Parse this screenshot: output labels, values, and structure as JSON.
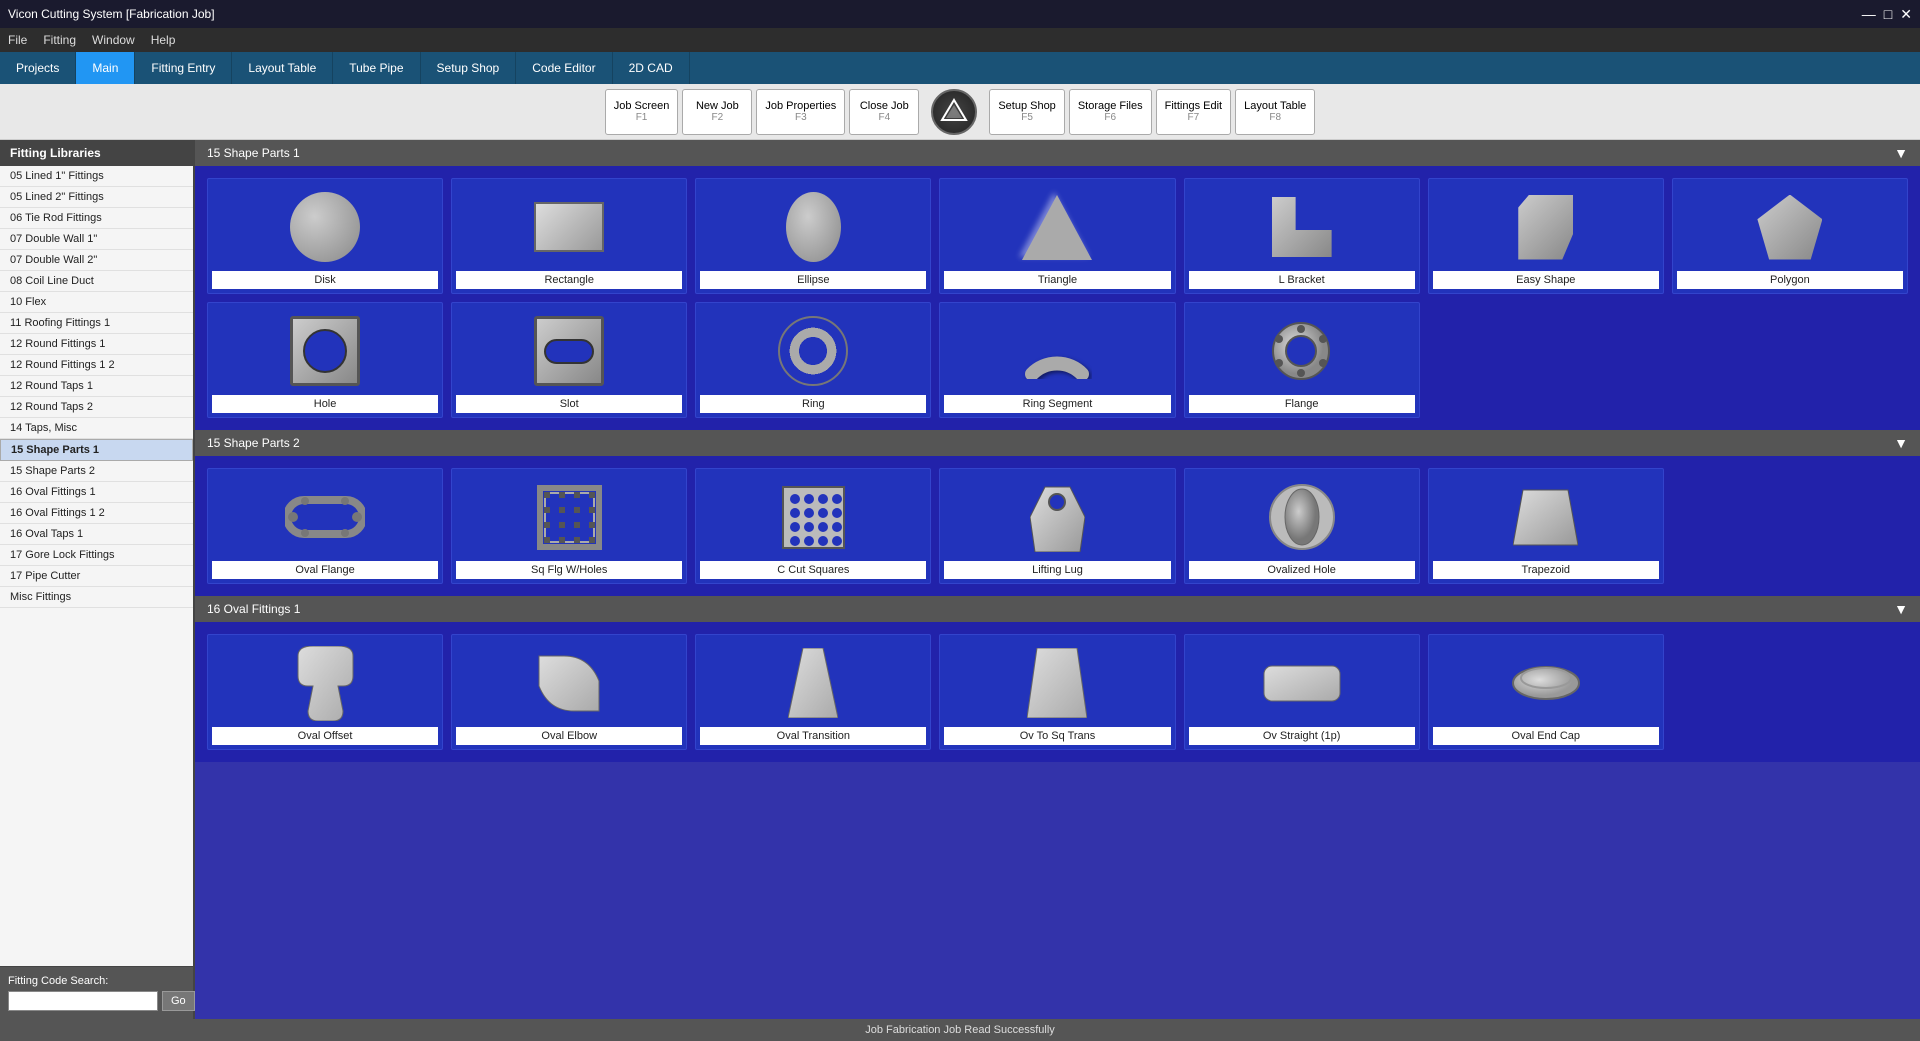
{
  "window": {
    "title": "Vicon Cutting System [Fabrication Job]",
    "controls": [
      "—",
      "□",
      "✕"
    ]
  },
  "menu": {
    "items": [
      "File",
      "Fitting",
      "Window",
      "Help"
    ]
  },
  "tabs": [
    {
      "label": "Projects",
      "active": false
    },
    {
      "label": "Main",
      "active": true
    },
    {
      "label": "Fitting Entry",
      "active": false
    },
    {
      "label": "Layout Table",
      "active": false
    },
    {
      "label": "Tube Pipe",
      "active": false
    },
    {
      "label": "Setup Shop",
      "active": false
    },
    {
      "label": "Code Editor",
      "active": false
    },
    {
      "label": "2D CAD",
      "active": false
    }
  ],
  "toolbar": {
    "buttons": [
      {
        "label": "Job\nScreen",
        "key": "F1"
      },
      {
        "label": "New\nJob",
        "key": "F2"
      },
      {
        "label": "Job\nProperties",
        "key": "F3"
      },
      {
        "label": "Close\nJob",
        "key": "F4"
      },
      {
        "label": "Setup\nShop",
        "key": "F5"
      },
      {
        "label": "Storage\nFiles",
        "key": "F6"
      },
      {
        "label": "Fittings\nEdit",
        "key": "F7"
      },
      {
        "label": "Layout\nTable",
        "key": "F8"
      }
    ]
  },
  "sidebar": {
    "header": "Fitting Libraries",
    "items": [
      "05 Lined 1\" Fittings",
      "05 Lined 2\" Fittings",
      "06 Tie Rod Fittings",
      "07 Double Wall 1\"",
      "07 Double Wall 2\"",
      "08 Coil Line Duct",
      "10 Flex",
      "11 Roofing Fittings 1",
      "12 Round Fittings 1",
      "12 Round Fittings 1 2",
      "12 Round Taps 1",
      "12 Round Taps 2",
      "14 Taps, Misc",
      "15 Shape Parts 1",
      "15 Shape Parts 2",
      "16 Oval Fittings 1",
      "16 Oval Fittings 1 2",
      "16 Oval Taps 1",
      "17 Gore Lock Fittings",
      "17 Pipe Cutter",
      "Misc Fittings"
    ],
    "selected_index": 13,
    "search_label": "Fitting Code Search:",
    "search_placeholder": "",
    "search_go": "Go"
  },
  "sections": [
    {
      "id": "section1",
      "header": "15 Shape Parts 1",
      "items": [
        {
          "label": "Disk",
          "shape": "disk"
        },
        {
          "label": "Rectangle",
          "shape": "rectangle"
        },
        {
          "label": "Ellipse",
          "shape": "ellipse"
        },
        {
          "label": "Triangle",
          "shape": "triangle"
        },
        {
          "label": "L Bracket",
          "shape": "lbracket"
        },
        {
          "label": "Easy Shape",
          "shape": "easyshape"
        },
        {
          "label": "Polygon",
          "shape": "polygon"
        },
        {
          "label": "Hole",
          "shape": "hole"
        },
        {
          "label": "Slot",
          "shape": "slot"
        },
        {
          "label": "Ring",
          "shape": "ring"
        },
        {
          "label": "Ring Segment",
          "shape": "ringsegment"
        },
        {
          "label": "Flange",
          "shape": "flange"
        }
      ]
    },
    {
      "id": "section2",
      "header": "15 Shape Parts 2",
      "items": [
        {
          "label": "Oval Flange",
          "shape": "ovalflange"
        },
        {
          "label": "Sq Flg W/Holes",
          "shape": "sqflg"
        },
        {
          "label": "C Cut Squares",
          "shape": "ccut"
        },
        {
          "label": "Lifting Lug",
          "shape": "liftinglug"
        },
        {
          "label": "Ovalized Hole",
          "shape": "ovalized"
        },
        {
          "label": "Trapezoid",
          "shape": "trapezoid"
        }
      ]
    },
    {
      "id": "section3",
      "header": "16 Oval Fittings 1",
      "items": [
        {
          "label": "Oval Offset",
          "shape": "ovaloffset"
        },
        {
          "label": "Oval Elbow",
          "shape": "ovalelbow"
        },
        {
          "label": "Oval Transition",
          "shape": "ovaltrans"
        },
        {
          "label": "Ov To Sq Trans",
          "shape": "ovtosq"
        },
        {
          "label": "Ov Straight (1p)",
          "shape": "ovstraight"
        },
        {
          "label": "Oval End Cap",
          "shape": "ovalendcap"
        }
      ]
    }
  ],
  "status": {
    "text": "Job Fabrication Job Read Successfully"
  }
}
